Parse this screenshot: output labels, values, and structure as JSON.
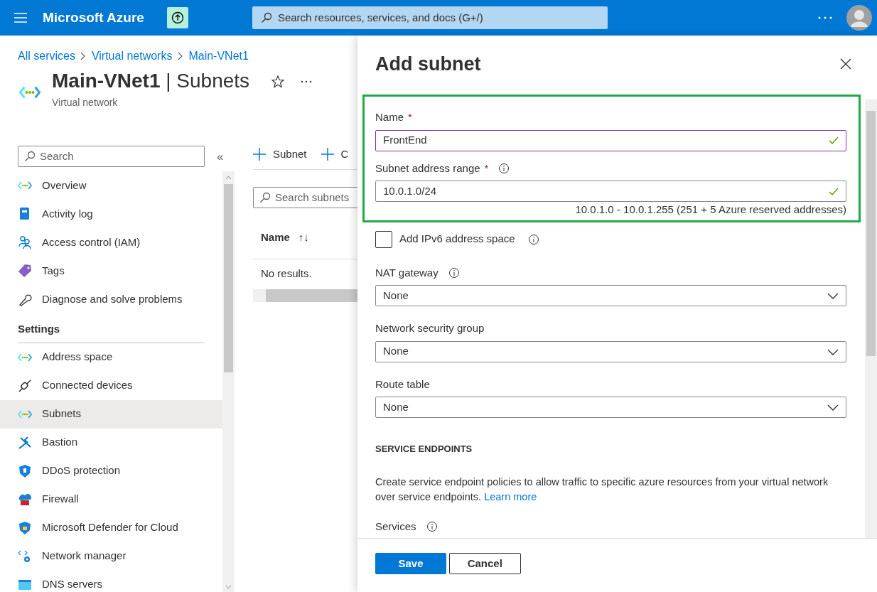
{
  "topbar": {
    "brand": "Microsoft Azure",
    "search_placeholder": "Search resources, services, and docs (G+/)"
  },
  "breadcrumbs": [
    "All services",
    "Virtual networks",
    "Main-VNet1"
  ],
  "resource": {
    "name": "Main-VNet1",
    "page": "Subnets",
    "separator": "|",
    "type": "Virtual network"
  },
  "sidebar": {
    "search_placeholder": "Search",
    "collapse": "«",
    "items": [
      {
        "label": "Overview",
        "selected": false
      },
      {
        "label": "Activity log",
        "selected": false
      },
      {
        "label": "Access control (IAM)",
        "selected": false
      },
      {
        "label": "Tags",
        "selected": false
      },
      {
        "label": "Diagnose and solve problems",
        "selected": false
      }
    ],
    "section": "Settings",
    "settings_items": [
      {
        "label": "Address space",
        "selected": false
      },
      {
        "label": "Connected devices",
        "selected": false
      },
      {
        "label": "Subnets",
        "selected": true
      },
      {
        "label": "Bastion",
        "selected": false
      },
      {
        "label": "DDoS protection",
        "selected": false
      },
      {
        "label": "Firewall",
        "selected": false
      },
      {
        "label": "Microsoft Defender for Cloud",
        "selected": false
      },
      {
        "label": "Network manager",
        "selected": false
      },
      {
        "label": "DNS servers",
        "selected": false
      }
    ]
  },
  "toolbar": [
    "Subnet",
    "C"
  ],
  "subnets": {
    "search_placeholder": "Search subnets",
    "column": "Name",
    "sort": "↑↓",
    "empty": "No results."
  },
  "panel": {
    "title": "Add subnet",
    "highlighted_fields": [
      {
        "label": "Name",
        "required_mark": "*",
        "info": false,
        "value": "FrontEnd",
        "valid": true,
        "focused": true
      },
      {
        "label": "Subnet address range",
        "required_mark": "*",
        "info": true,
        "value": "10.0.1.0/24",
        "valid": true,
        "focused": false
      }
    ],
    "range_hint": "10.0.1.0 - 10.0.1.255 (251 + 5 Azure reserved addresses)",
    "ipv6": {
      "label": "Add IPv6 address space",
      "checked": false
    },
    "dropdowns": [
      {
        "label": "NAT gateway",
        "info": true,
        "value": "None"
      },
      {
        "label": "Network security group",
        "info": false,
        "value": "None"
      },
      {
        "label": "Route table",
        "info": false,
        "value": "None"
      }
    ],
    "section_heading": "SERVICE ENDPOINTS",
    "description": "Create service endpoint policies to allow traffic to specific azure resources from your virtual network over service endpoints.",
    "learn_more": "Learn more",
    "services_label": "Services",
    "buttons": [
      "Save",
      "Cancel"
    ]
  }
}
